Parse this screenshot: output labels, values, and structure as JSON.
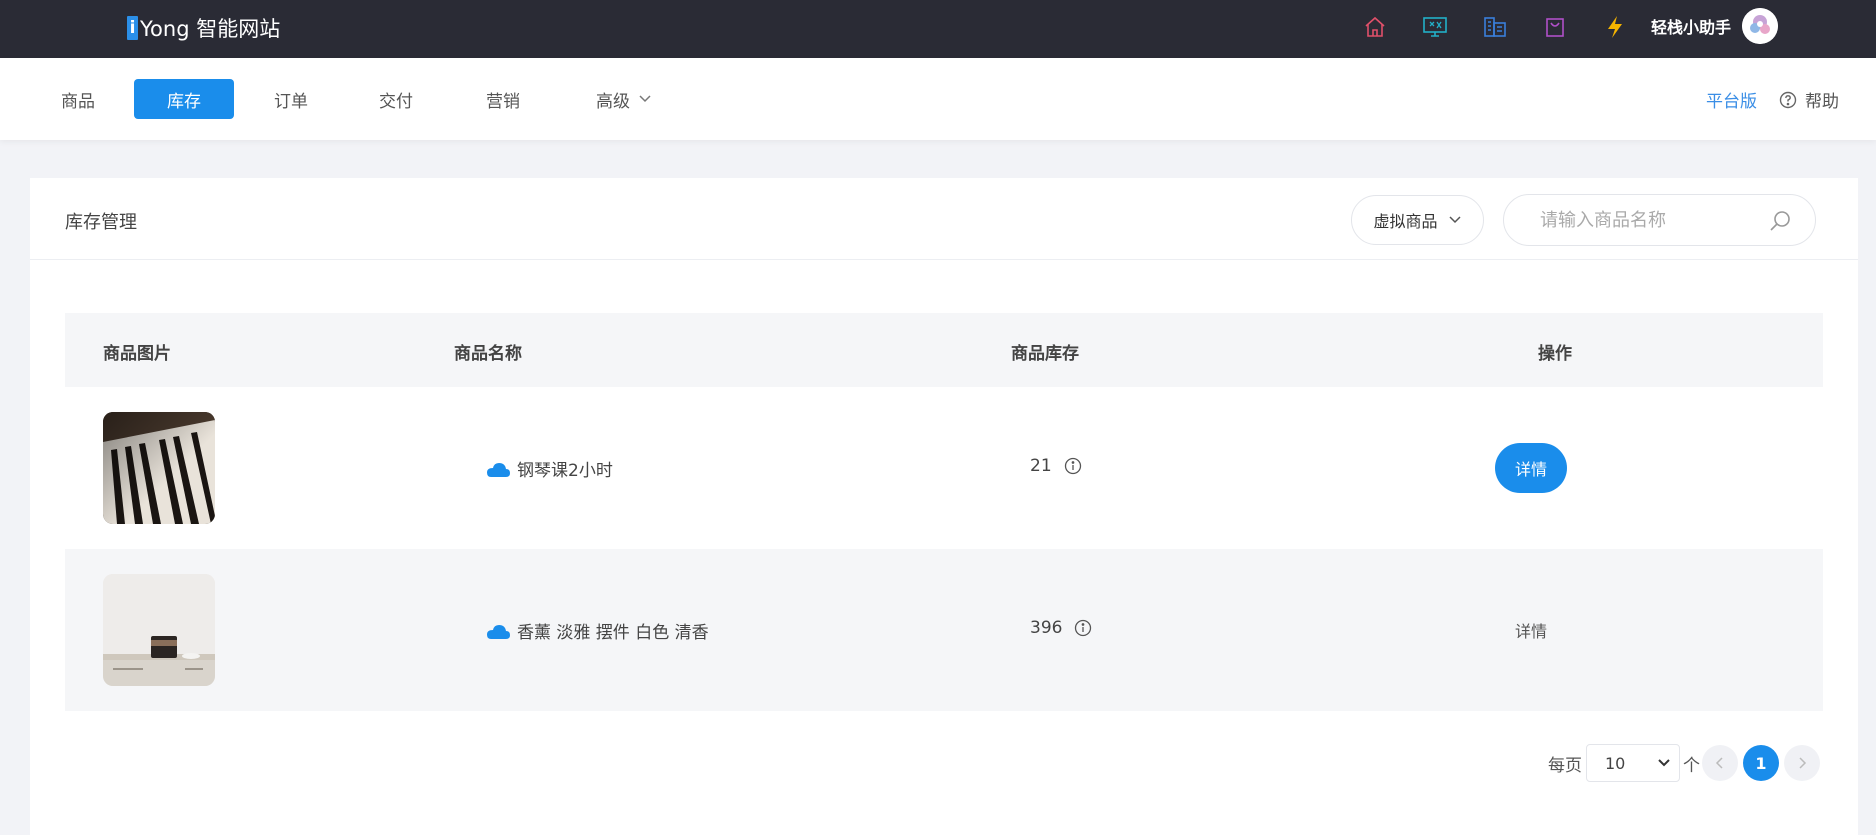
{
  "header": {
    "brand_badge": "i",
    "brand_text": "Yong 智能网站",
    "user_name": "轻栈小助手",
    "icons": [
      "home-icon",
      "monitor-icon",
      "building-icon",
      "bag-icon",
      "lightning-icon"
    ],
    "colors": {
      "home": "#e0506a",
      "monitor": "#22b0c8",
      "building": "#3a7fdc",
      "bag": "#b04fc8",
      "lightning": "#f5b400"
    }
  },
  "nav": {
    "items": [
      "商品",
      "库存",
      "订单",
      "交付",
      "营销",
      "高级"
    ],
    "active": "库存",
    "platform": "平台版",
    "help": "帮助"
  },
  "card": {
    "title": "库存管理",
    "type_filter": "虚拟商品",
    "search_placeholder": "请输入商品名称"
  },
  "table": {
    "columns": [
      "商品图片",
      "商品名称",
      "商品库存",
      "操作"
    ],
    "rows": [
      {
        "name": "钢琴课2小时",
        "stock": "21",
        "action": "详情"
      },
      {
        "name": "香薰 淡雅 摆件 白色 清香",
        "stock": "396",
        "action": "详情"
      }
    ]
  },
  "pagination": {
    "per_page_label": "每页",
    "per_page_value": "10",
    "unit": "个",
    "current_page": "1"
  },
  "accent_color": "#1a8deb"
}
